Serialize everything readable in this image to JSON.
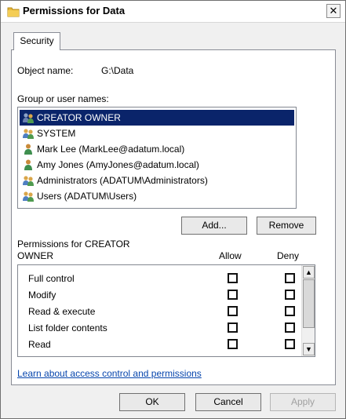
{
  "window": {
    "title": "Permissions for Data",
    "close_glyph": "✕"
  },
  "tab": {
    "label": "Security"
  },
  "object": {
    "label": "Object name:",
    "value": "G:\\Data"
  },
  "groups": {
    "label": "Group or user names:",
    "items": [
      {
        "label": "CREATOR OWNER",
        "icon": "group-icon"
      },
      {
        "label": "SYSTEM",
        "icon": "group-icon"
      },
      {
        "label": "Mark Lee (MarkLee@adatum.local)",
        "icon": "user-icon"
      },
      {
        "label": "Amy Jones (AmyJones@adatum.local)",
        "icon": "user-icon"
      },
      {
        "label": "Administrators (ADATUM\\Administrators)",
        "icon": "group-icon"
      },
      {
        "label": "Users (ADATUM\\Users)",
        "icon": "group-icon"
      }
    ],
    "selected_index": 0
  },
  "group_buttons": {
    "add": "Add...",
    "remove": "Remove"
  },
  "permissions": {
    "title_line1": "Permissions for CREATOR",
    "title_line2": "OWNER",
    "allow_header": "Allow",
    "deny_header": "Deny",
    "rows": [
      {
        "name": "Full control",
        "allow": false,
        "deny": false
      },
      {
        "name": "Modify",
        "allow": false,
        "deny": false
      },
      {
        "name": "Read & execute",
        "allow": false,
        "deny": false
      },
      {
        "name": "List folder contents",
        "allow": false,
        "deny": false
      },
      {
        "name": "Read",
        "allow": false,
        "deny": false
      }
    ]
  },
  "help_link": "Learn about access control and permissions",
  "footer": {
    "ok": "OK",
    "cancel": "Cancel",
    "apply": "Apply"
  },
  "colors": {
    "selection": "#0a246a",
    "link": "#0645ad",
    "folder": "#e8b83a"
  }
}
